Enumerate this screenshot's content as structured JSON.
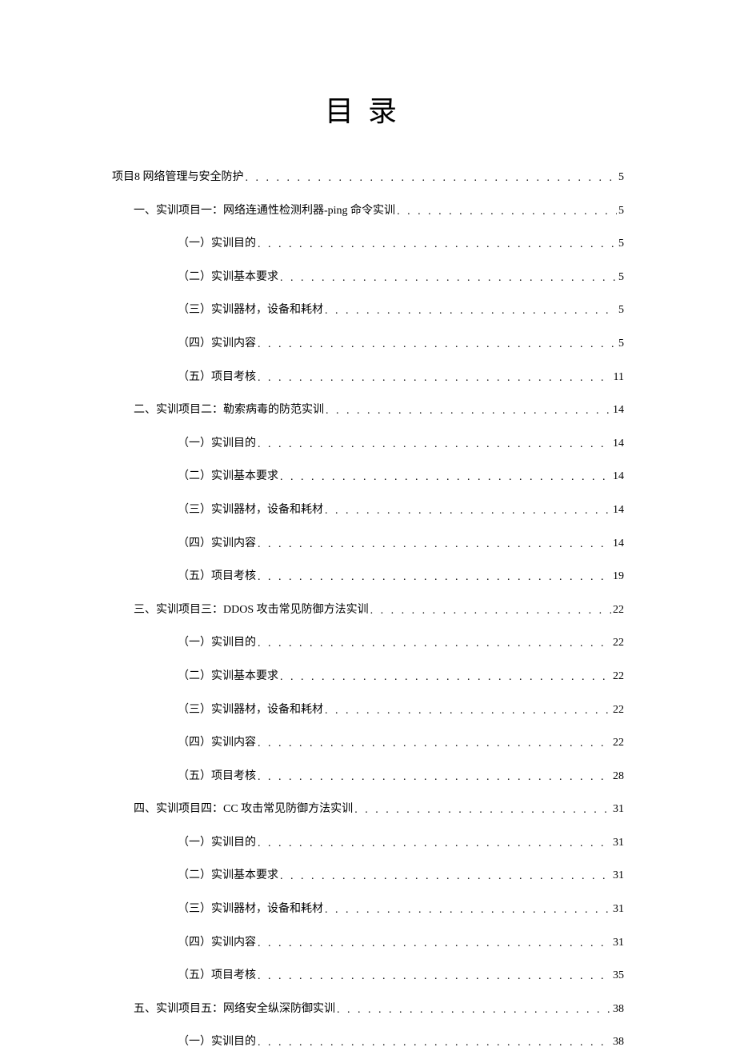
{
  "title": "目录",
  "entries": [
    {
      "level": 0,
      "label": "项目8 网络管理与安全防护",
      "page": "5"
    },
    {
      "level": 1,
      "label": "一、实训项目一：网络连通性检测利器-ping 命令实训",
      "page": "5"
    },
    {
      "level": 2,
      "label": "（一）实训目的",
      "page": "5"
    },
    {
      "level": 2,
      "label": "（二）实训基本要求",
      "page": "5"
    },
    {
      "level": 2,
      "label": "（三）实训器材，设备和耗材",
      "page": "5"
    },
    {
      "level": 2,
      "label": "（四）实训内容",
      "page": "5"
    },
    {
      "level": 2,
      "label": "（五）项目考核",
      "page": "11"
    },
    {
      "level": 1,
      "label": "二、实训项目二：勒索病毒的防范实训",
      "page": "14"
    },
    {
      "level": 2,
      "label": "（一）实训目的",
      "page": "14"
    },
    {
      "level": 2,
      "label": "（二）实训基本要求",
      "page": "14"
    },
    {
      "level": 2,
      "label": "（三）实训器材，设备和耗材",
      "page": "14"
    },
    {
      "level": 2,
      "label": "（四）实训内容",
      "page": "14"
    },
    {
      "level": 2,
      "label": "（五）项目考核",
      "page": "19"
    },
    {
      "level": 1,
      "label": "三、实训项目三：DDOS 攻击常见防御方法实训",
      "page": "22"
    },
    {
      "level": 2,
      "label": "（一）实训目的",
      "page": "22"
    },
    {
      "level": 2,
      "label": "（二）实训基本要求",
      "page": "22"
    },
    {
      "level": 2,
      "label": "（三）实训器材，设备和耗材",
      "page": "22"
    },
    {
      "level": 2,
      "label": "（四）实训内容",
      "page": "22"
    },
    {
      "level": 2,
      "label": "（五）项目考核",
      "page": "28"
    },
    {
      "level": 1,
      "label": "四、实训项目四：CC 攻击常见防御方法实训",
      "page": "31"
    },
    {
      "level": 2,
      "label": "（一）实训目的",
      "page": "31"
    },
    {
      "level": 2,
      "label": "（二）实训基本要求",
      "page": "31"
    },
    {
      "level": 2,
      "label": "（三）实训器材，设备和耗材",
      "page": "31"
    },
    {
      "level": 2,
      "label": "（四）实训内容",
      "page": "31"
    },
    {
      "level": 2,
      "label": "（五）项目考核",
      "page": "35"
    },
    {
      "level": 1,
      "label": "五、实训项目五：网络安全纵深防御实训",
      "page": "38"
    },
    {
      "level": 2,
      "label": "（一）实训目的",
      "page": "38"
    }
  ]
}
